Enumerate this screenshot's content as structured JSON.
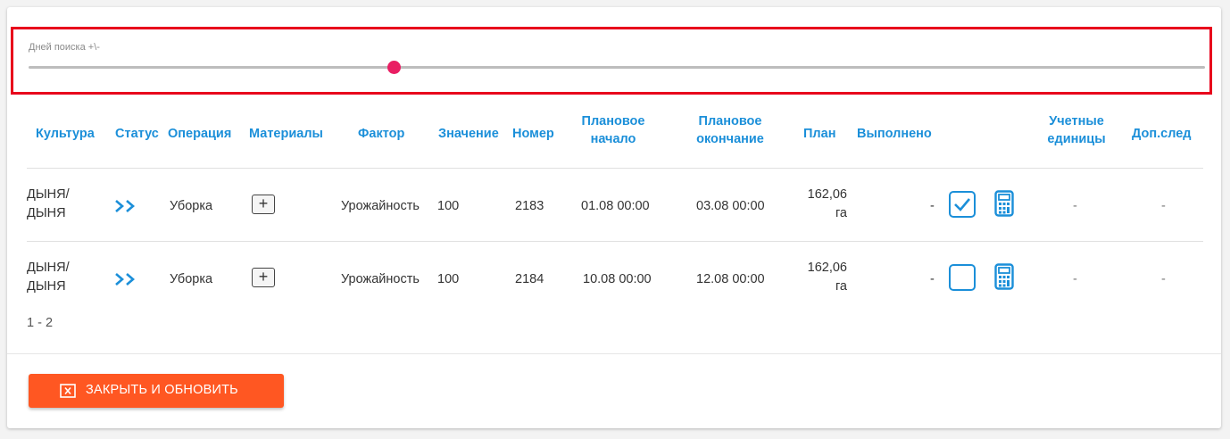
{
  "slider": {
    "label": "Дней поиска +\\-",
    "value_fraction": 0.31
  },
  "table": {
    "headers": {
      "culture": "Культура",
      "status": "Статус",
      "operation": "Операция",
      "materials": "Материалы",
      "factor": "Фактор",
      "value": "Значение",
      "number": "Номер",
      "plan_start_1": "Плановое",
      "plan_start_2": "начало",
      "plan_end_1": "Плановое",
      "plan_end_2": "окончание",
      "plan": "План",
      "done": "Выполнено",
      "units_1": "Учетные",
      "units_2": "единицы",
      "extra": "Доп.след"
    },
    "rows": [
      {
        "culture_1": "ДЫНЯ/",
        "culture_2": "ДЫНЯ",
        "operation": "Уборка",
        "materials_btn": "+",
        "factor": "Урожайность",
        "value": "100",
        "number": "2183",
        "plan_start": "01.08 00:00",
        "plan_end": "03.08 00:00",
        "plan_1": "162,06",
        "plan_2": "га",
        "done_text": "-",
        "checked": true,
        "units": "-",
        "extra": "-"
      },
      {
        "culture_1": "ДЫНЯ/",
        "culture_2": "ДЫНЯ",
        "operation": "Уборка",
        "materials_btn": "+",
        "factor": "Урожайность",
        "value": "100",
        "number": "2184",
        "plan_start": "10.08 00:00",
        "plan_end": "12.08 00:00",
        "plan_1": "162,06",
        "plan_2": "га",
        "done_text": "-",
        "checked": false,
        "units": "-",
        "extra": "-"
      }
    ],
    "pager": "1 - 2"
  },
  "footer": {
    "close_button": "ЗАКРЫТЬ И ОБНОВИТЬ"
  },
  "colors": {
    "accent": "#1b8fd9",
    "slider": "#e91e63",
    "button": "#ff5722",
    "highlight": "#e8001c"
  }
}
